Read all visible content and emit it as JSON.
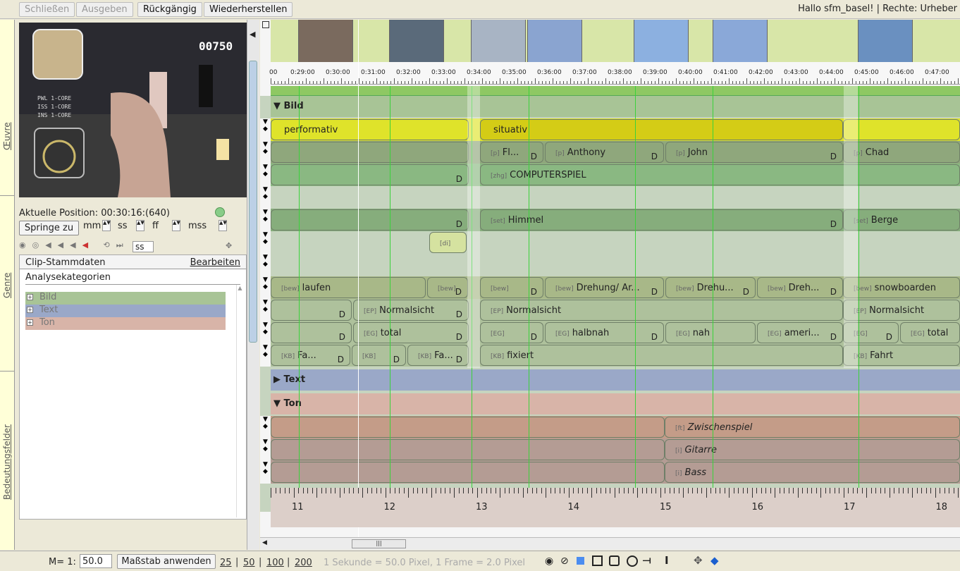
{
  "toolbar": {
    "close": "Schließen",
    "output": "Ausgeben",
    "undo": "Rückgängig",
    "redo": "Wiederherstellen"
  },
  "greeting": "Hallo sfm_basel!  |  Rechte: Urheber",
  "sidebar_tabs": [
    "Œuvre",
    "Genre",
    "Bedeutungsfelder"
  ],
  "video_overlay": "00750",
  "position": {
    "label": "Aktuelle Position:",
    "value": "00:30:16:(640)"
  },
  "jump": {
    "button": "Springe zu",
    "mm": "mm",
    "ss": "ss",
    "ff": "ff",
    "mss": "mss",
    "ss2": "ss"
  },
  "clip": {
    "title": "Clip-Stammdaten",
    "edit": "Bearbeiten",
    "categories_title": "Analysekategorien",
    "categories": [
      {
        "label": "Bild",
        "color": "#a8c496"
      },
      {
        "label": "Text",
        "color": "#9aa8c8"
      },
      {
        "label": "Ton",
        "color": "#d8b4a8"
      }
    ]
  },
  "timecodes": [
    "00",
    "0:29:00",
    "0:30:00",
    "0:31:00",
    "0:32:00",
    "0:33:00",
    "0:34:00",
    "0:35:00",
    "0:36:00",
    "0:37:00",
    "0:38:00",
    "0:39:00",
    "0:40:00",
    "0:41:00",
    "0:42:00",
    "0:43:00",
    "0:44:00",
    "0:45:00",
    "0:46:00",
    "0:47:00"
  ],
  "groups": {
    "bild": "▼ Bild",
    "text": "▶ Text",
    "ton": "▼ Ton"
  },
  "bild_tracks": [
    {
      "color": "#dfe32a",
      "segs": [
        {
          "tag": "",
          "label": "performativ",
          "d": ""
        },
        {
          "tag": "",
          "label": "situativ",
          "d": ""
        }
      ]
    },
    {
      "color": "#8fa77c",
      "segs": [
        {
          "tag": "[p]",
          "label": "Fl...",
          "d": "D"
        },
        {
          "tag": "[p]",
          "label": "Anthony",
          "d": "D"
        },
        {
          "tag": "[p]",
          "label": "John",
          "d": "D"
        },
        {
          "tag": "[p]",
          "label": "Chad",
          "d": ""
        }
      ]
    },
    {
      "color": "#8ab882",
      "segs": [
        {
          "tag": "",
          "label": "",
          "d": "D"
        },
        {
          "tag": "[zhg]",
          "label": "COMPUTERSPIEL",
          "d": ""
        }
      ]
    },
    {
      "color": "#c6d4bf",
      "segs": []
    },
    {
      "color": "#86ad7c",
      "segs": [
        {
          "tag": "",
          "label": "",
          "d": "D"
        },
        {
          "tag": "[set]",
          "label": "Himmel",
          "d": "D"
        },
        {
          "tag": "[set]",
          "label": "Berge",
          "d": ""
        }
      ]
    },
    {
      "color": "#c6d4bf",
      "segs": [
        {
          "tag": "[di]",
          "label": "",
          "d": ""
        }
      ]
    },
    {
      "color": "#c6d4bf",
      "segs": []
    },
    {
      "color": "#a8b888",
      "segs": [
        {
          "tag": "[bew]",
          "label": "laufen",
          "d": ""
        },
        {
          "tag": "[bew]",
          "label": "",
          "d": "D"
        },
        {
          "tag": "[bew]",
          "label": "",
          "d": "D"
        },
        {
          "tag": "[bew]",
          "label": "Drehung/ Ar...",
          "d": "D"
        },
        {
          "tag": "[bew]",
          "label": "Drehu...",
          "d": "D"
        },
        {
          "tag": "[bew]",
          "label": "Dreh...",
          "d": "D"
        },
        {
          "tag": "[bew]",
          "label": "snowboarden",
          "d": ""
        }
      ]
    },
    {
      "color": "#aec19c",
      "segs": [
        {
          "tag": "",
          "label": "",
          "d": "D"
        },
        {
          "tag": "[EP]",
          "label": "Normalsicht",
          "d": "D"
        },
        {
          "tag": "[EP]",
          "label": "Normalsicht",
          "d": ""
        },
        {
          "tag": "[EP]",
          "label": "Normalsicht",
          "d": ""
        }
      ]
    },
    {
      "color": "#aec19c",
      "segs": [
        {
          "tag": "",
          "label": "",
          "d": "D"
        },
        {
          "tag": "[EG]",
          "label": "total",
          "d": "D"
        },
        {
          "tag": "[EG]",
          "label": "",
          "d": "D"
        },
        {
          "tag": "[EG]",
          "label": "halbnah",
          "d": "D"
        },
        {
          "tag": "[EG]",
          "label": "nah",
          "d": ""
        },
        {
          "tag": "[EG]",
          "label": "ameri...",
          "d": "D"
        },
        {
          "tag": "[EG]",
          "label": "",
          "d": "D"
        },
        {
          "tag": "[EG]",
          "label": "total",
          "d": ""
        }
      ]
    },
    {
      "color": "#aec19c",
      "segs": [
        {
          "tag": "[KB]",
          "label": "Fa...",
          "d": "D"
        },
        {
          "tag": "[KB]",
          "label": "",
          "d": "D"
        },
        {
          "tag": "[KB]",
          "label": "Fa...",
          "d": "D"
        },
        {
          "tag": "[KB]",
          "label": "fixiert",
          "d": ""
        },
        {
          "tag": "[KB]",
          "label": "Fahrt",
          "d": ""
        }
      ]
    }
  ],
  "ton_tracks": [
    {
      "color": "#c49c88",
      "segs": [
        {
          "tag": "",
          "label": "",
          "d": ""
        },
        {
          "tag": "[ft]",
          "label": "Zwischenspiel",
          "d": ""
        }
      ]
    },
    {
      "color": "#b49c94",
      "segs": [
        {
          "tag": "",
          "label": "",
          "d": ""
        },
        {
          "tag": "[i]",
          "label": "Gitarre",
          "d": ""
        }
      ]
    },
    {
      "color": "#b49c94",
      "segs": [
        {
          "tag": "",
          "label": "",
          "d": ""
        },
        {
          "tag": "[i]",
          "label": "Bass",
          "d": ""
        }
      ]
    }
  ],
  "ruler": [
    "11",
    "12",
    "13",
    "14",
    "15",
    "16",
    "17",
    "18"
  ],
  "bottom": {
    "scale_label": "M= 1:",
    "scale_value": "50.0",
    "apply": "Maßstab anwenden",
    "links": [
      "25",
      "50",
      "100",
      "200"
    ],
    "info": "1 Sekunde = 50.0 Pixel, 1 Frame = 2.0 Pixel"
  }
}
